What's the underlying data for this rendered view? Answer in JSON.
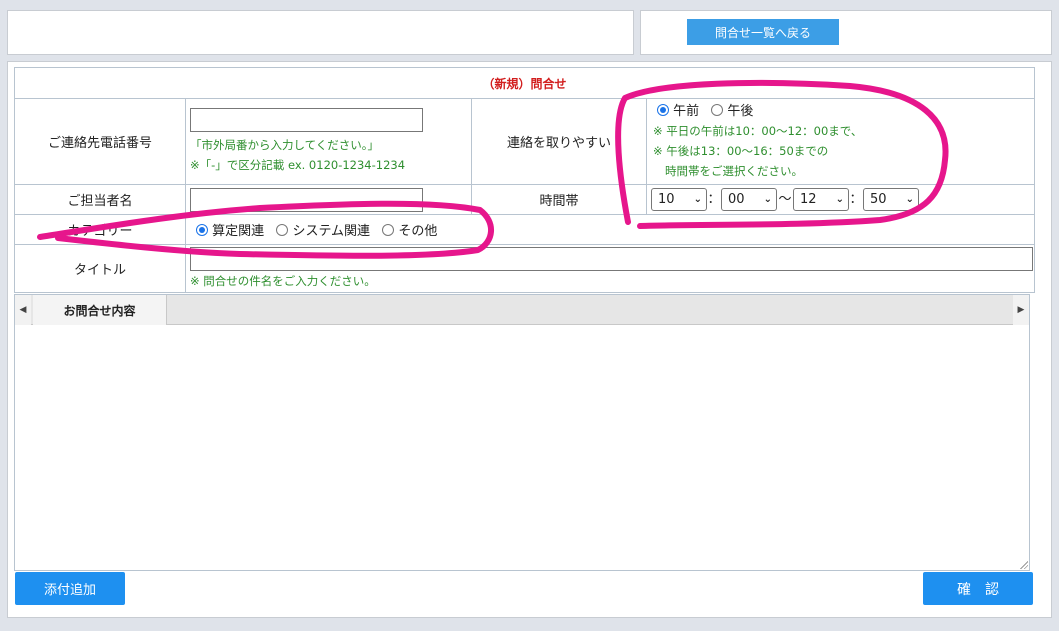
{
  "header": {
    "back_button": "問合せ一覧へ戻る"
  },
  "form": {
    "title": "（新規）問合せ",
    "phone": {
      "label": "ご連絡先電話番号",
      "value": "",
      "note1": "「市外局番から入力してください。」",
      "note2": "※「-」で区分記載 ex. 0120-1234-1234"
    },
    "contact_time": {
      "label": "連絡を取りやすい",
      "am": "午前",
      "pm": "午後",
      "selected": "午前",
      "note1": "※ 平日の午前は10：00～12：00まで、",
      "note2": "※ 午後は13：00～16：50までの",
      "note3": "時間帯をご選択ください。"
    },
    "person": {
      "label": "ご担当者名",
      "value": ""
    },
    "time_range": {
      "label": "時間帯",
      "from_hour": "10",
      "from_min": "00",
      "tilde": "～",
      "to_hour": "12",
      "to_min": "50",
      "colon": "："
    },
    "category": {
      "label": "カテゴリー",
      "options": [
        "算定関連",
        "システム関連",
        "その他"
      ],
      "selected": "算定関連"
    },
    "title_field": {
      "label": "タイトル",
      "value": "",
      "note": "※ 問合せの件名をご入力ください。"
    }
  },
  "editor": {
    "tab_label": "お問合せ内容",
    "content": ""
  },
  "footer": {
    "attach_button": "添付追加",
    "confirm_button": "確　認"
  },
  "colors": {
    "accent": "#1e90f0",
    "highlight": "#e6168c",
    "note_green": "#2f8f2f",
    "title_red": "#d21e1e"
  }
}
